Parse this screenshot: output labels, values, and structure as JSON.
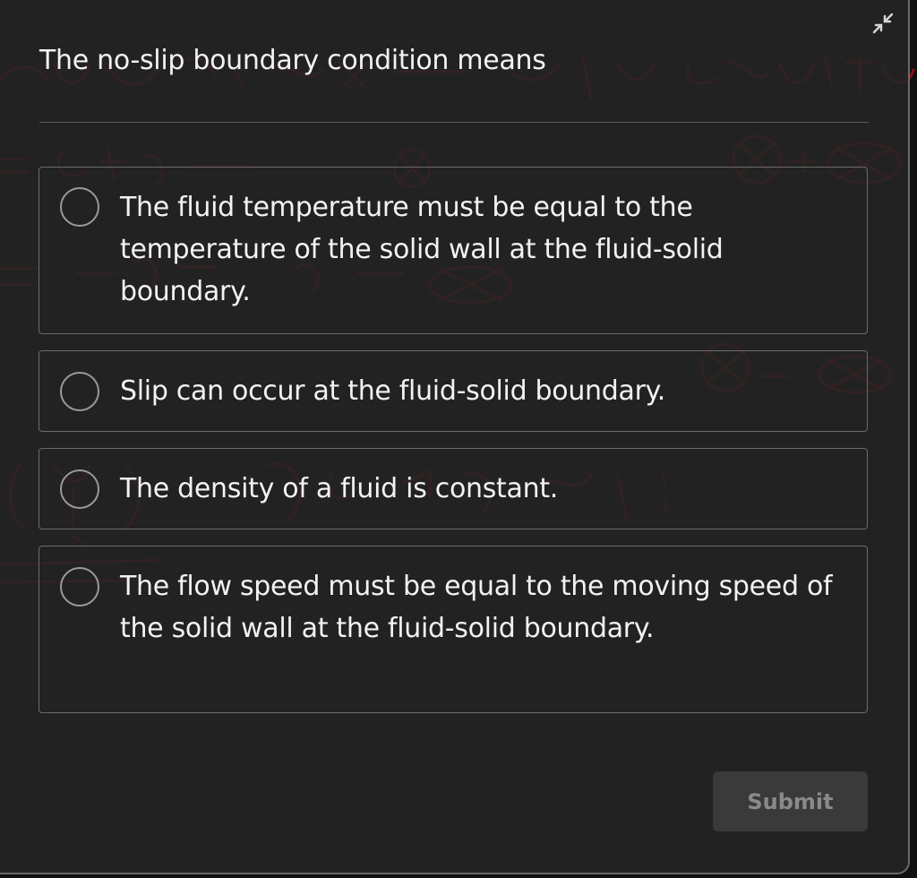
{
  "question": {
    "text": "The no-slip boundary condition means"
  },
  "options": [
    {
      "label": "The fluid temperature must be equal to the temperature of the solid wall at the fluid-solid boundary.",
      "selected": false
    },
    {
      "label": "Slip can occur at the fluid-solid boundary.",
      "selected": false
    },
    {
      "label": "The density of a fluid is constant.",
      "selected": false
    },
    {
      "label": "The flow speed must be equal to the moving speed of the solid wall at the fluid-solid boundary.",
      "selected": false
    }
  ],
  "actions": {
    "submit_label": "Submit",
    "submit_enabled": false
  },
  "icons": {
    "collapse": "collapse-arrows-icon",
    "radio": "radio-unchecked-icon"
  },
  "colors": {
    "panel_bg": "#242424",
    "text": "#f2f2f2",
    "border": "#6c6c6c",
    "submit_bg": "#3a3a3a",
    "submit_text": "#8a8a8a",
    "backdrop_ink": "#c0141c"
  }
}
